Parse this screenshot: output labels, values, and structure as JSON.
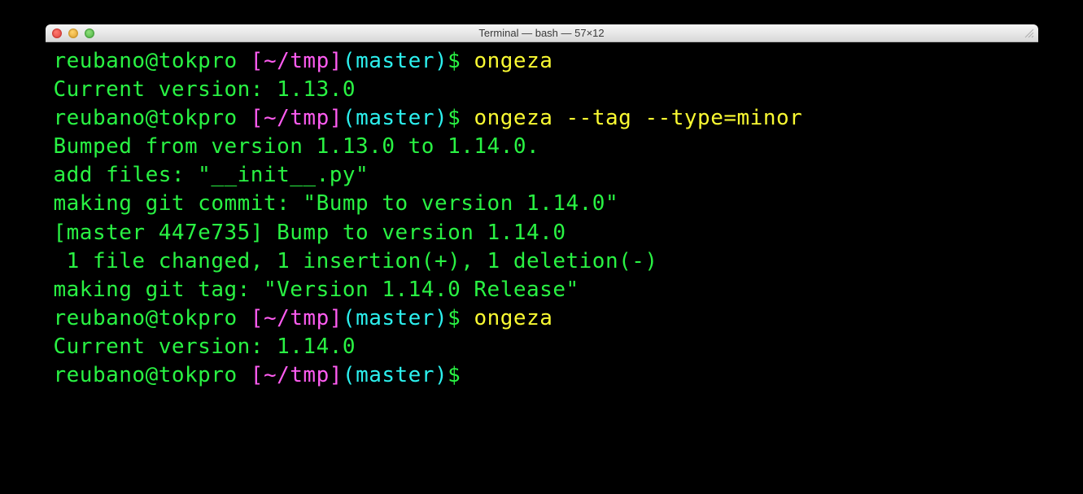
{
  "window": {
    "title": "Terminal — bash — 57×12"
  },
  "prompt": {
    "user_host": "reubano@tokpro",
    "path_open": " [",
    "path": "~/tmp",
    "path_close": "]",
    "branch_open": "(",
    "branch": "master",
    "branch_close": ")",
    "dollar": "$ "
  },
  "lines": {
    "cmd1": "ongeza",
    "out1": "Current version: 1.13.0",
    "cmd2": "ongeza --tag --type=minor",
    "out2a": "Bumped from version 1.13.0 to 1.14.0.",
    "out2b": "add files: \"__init__.py\"",
    "out2c": "making git commit: \"Bump to version 1.14.0\"",
    "out2d": "[master 447e735] Bump to version 1.14.0",
    "out2e": " 1 file changed, 1 insertion(+), 1 deletion(-)",
    "out2f": "making git tag: \"Version 1.14.0 Release\"",
    "cmd3": "ongeza",
    "out3": "Current version: 1.14.0"
  }
}
